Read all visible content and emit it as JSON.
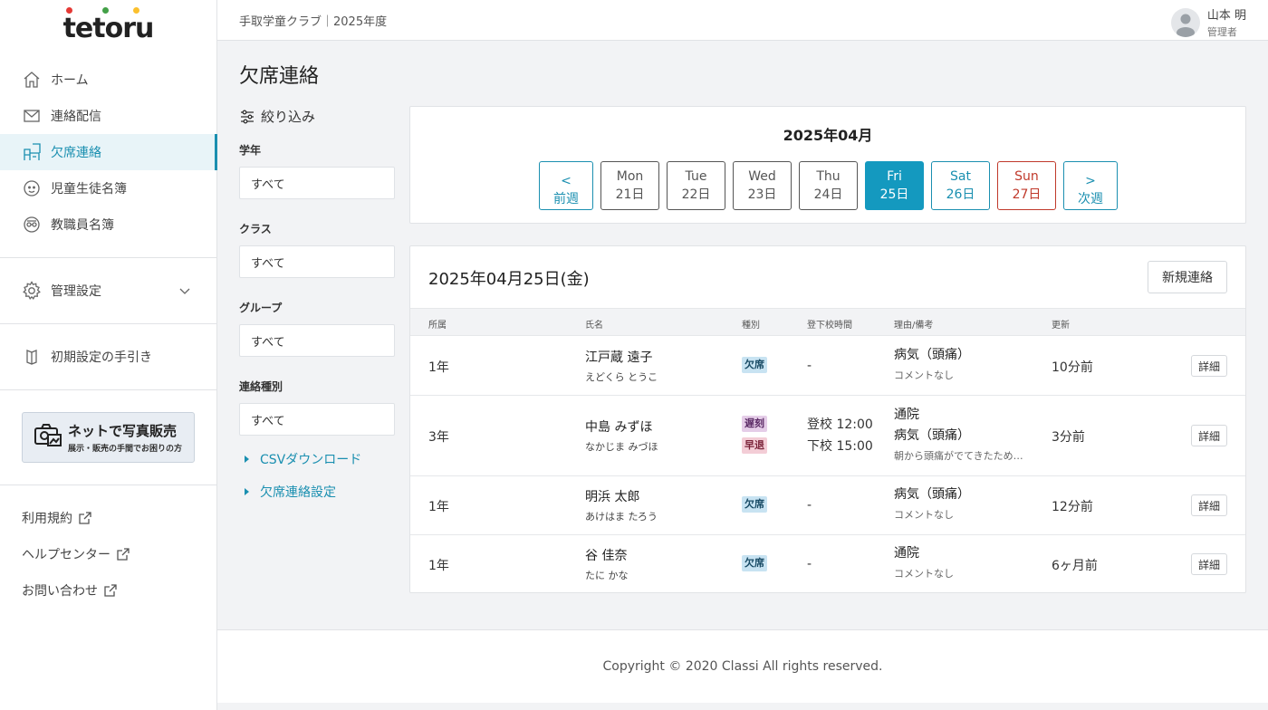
{
  "logo": {
    "text": "tetoru",
    "dot_colors": [
      "#e53935",
      "#43a047",
      "#fbc02d"
    ]
  },
  "sidebar": {
    "nav": [
      {
        "label": "ホーム",
        "icon": "home-icon"
      },
      {
        "label": "連絡配信",
        "icon": "mail-icon"
      },
      {
        "label": "欠席連絡",
        "icon": "absence-icon",
        "active": true
      },
      {
        "label": "児童生徒名簿",
        "icon": "student-icon"
      },
      {
        "label": "教職員名簿",
        "icon": "staff-icon"
      }
    ],
    "settings_label": "管理設定",
    "guide_label": "初期設定の手引き",
    "promo_title": "ネットで写真販売",
    "promo_sub": "展示・販売の手間でお困りの方",
    "links": [
      "利用規約",
      "ヘルプセンター",
      "お問い合わせ"
    ]
  },
  "header": {
    "title": "手取学童クラブ｜2025年度",
    "user_name": "山本 明",
    "user_role": "管理者"
  },
  "page_title": "欠席連絡",
  "filters": {
    "heading": "絞り込み",
    "groups": [
      {
        "label": "学年",
        "value": "すべて"
      },
      {
        "label": "クラス",
        "value": "すべて"
      },
      {
        "label": "グループ",
        "value": "すべて"
      },
      {
        "label": "連絡種別",
        "value": "すべて"
      }
    ],
    "links": [
      "CSVダウンロード",
      "欠席連絡設定"
    ]
  },
  "calendar": {
    "month": "2025年04月",
    "prev": {
      "arrow": "<",
      "label": "前週"
    },
    "next": {
      "arrow": ">",
      "label": "次週"
    },
    "days": [
      {
        "dow": "Mon",
        "date": "21日",
        "kind": "normal"
      },
      {
        "dow": "Tue",
        "date": "22日",
        "kind": "normal"
      },
      {
        "dow": "Wed",
        "date": "23日",
        "kind": "normal"
      },
      {
        "dow": "Thu",
        "date": "24日",
        "kind": "normal"
      },
      {
        "dow": "Fri",
        "date": "25日",
        "kind": "active"
      },
      {
        "dow": "Sat",
        "date": "26日",
        "kind": "sat"
      },
      {
        "dow": "Sun",
        "date": "27日",
        "kind": "sun"
      }
    ]
  },
  "list": {
    "date_title": "2025年04月25日(金)",
    "new_button": "新規連絡",
    "columns": [
      "所属",
      "氏名",
      "種別",
      "登下校時間",
      "理由/備考",
      "更新"
    ],
    "detail_label": "詳細",
    "rows": [
      {
        "grade": "1年",
        "name": "江戸蔵 遠子",
        "kana": "えどくら とうこ",
        "types": [
          {
            "label": "欠席",
            "kind": "abs"
          }
        ],
        "times": [
          "-"
        ],
        "reasons": [
          "病気（頭痛）"
        ],
        "note": "コメントなし",
        "updated": "10分前"
      },
      {
        "grade": "3年",
        "name": "中島 みずほ",
        "kana": "なかじま みづほ",
        "types": [
          {
            "label": "遅刻",
            "kind": "late"
          },
          {
            "label": "早退",
            "kind": "early"
          }
        ],
        "times": [
          "登校 12:00",
          "下校 15:00"
        ],
        "reasons": [
          "通院",
          "病気（頭痛）"
        ],
        "note": "朝から頭痛がでてきたため…",
        "updated": "3分前"
      },
      {
        "grade": "1年",
        "name": "明浜 太郎",
        "kana": "あけはま たろう",
        "types": [
          {
            "label": "欠席",
            "kind": "abs"
          }
        ],
        "times": [
          "-"
        ],
        "reasons": [
          "病気（頭痛）"
        ],
        "note": "コメントなし",
        "updated": "12分前"
      },
      {
        "grade": "1年",
        "name": "谷 佳奈",
        "kana": "たに かな",
        "types": [
          {
            "label": "欠席",
            "kind": "abs"
          }
        ],
        "times": [
          "-"
        ],
        "reasons": [
          "通院"
        ],
        "note": "コメントなし",
        "updated": "6ヶ月前"
      }
    ]
  },
  "footer": "Copyright © 2020 Classi All rights reserved."
}
